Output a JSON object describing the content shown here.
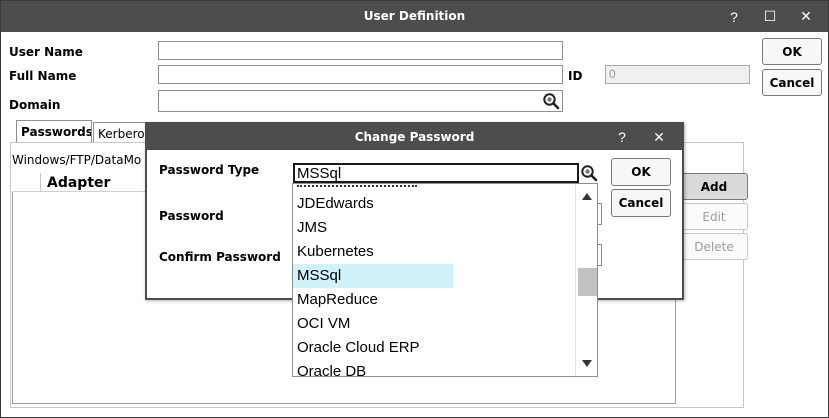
{
  "window": {
    "title": "User Definition",
    "help": "?",
    "maximize": "☐",
    "close": "✕"
  },
  "form": {
    "user_name_label": "User Name",
    "full_name_label": "Full Name",
    "domain_label": "Domain",
    "id_label": "ID",
    "user_name_value": "",
    "full_name_value": "",
    "domain_value": "",
    "id_value": "0"
  },
  "buttons": {
    "ok": "OK",
    "cancel": "Cancel",
    "add": "Add",
    "edit": "Edit",
    "delete": "Delete"
  },
  "tabs": [
    {
      "label": "Passwords"
    },
    {
      "label": "Kerberos"
    }
  ],
  "passwords_panel": {
    "section_label": "Windows/FTP/DataMo",
    "column_adapter": "Adapter"
  },
  "dialog": {
    "title": "Change Password",
    "help": "?",
    "close": "✕",
    "password_type_label": "Password Type",
    "password_label": "Password",
    "confirm_password_label": "Confirm Password",
    "password_type_value": "MSSql",
    "ok": "OK",
    "cancel": "Cancel"
  },
  "dropdown": {
    "items": [
      {
        "label": "JDEdwards",
        "selected": false
      },
      {
        "label": "JMS",
        "selected": false
      },
      {
        "label": "Kubernetes",
        "selected": false
      },
      {
        "label": "MSSql",
        "selected": true
      },
      {
        "label": "MapReduce",
        "selected": false
      },
      {
        "label": "OCI VM",
        "selected": false
      },
      {
        "label": "Oracle Cloud ERP",
        "selected": false
      },
      {
        "label": "Oracle DB",
        "selected": false
      }
    ]
  },
  "colors": {
    "titlebar": "#4d4d4d",
    "selection": "#d1f2fb",
    "scroll_thumb": "#c1c1c1"
  }
}
